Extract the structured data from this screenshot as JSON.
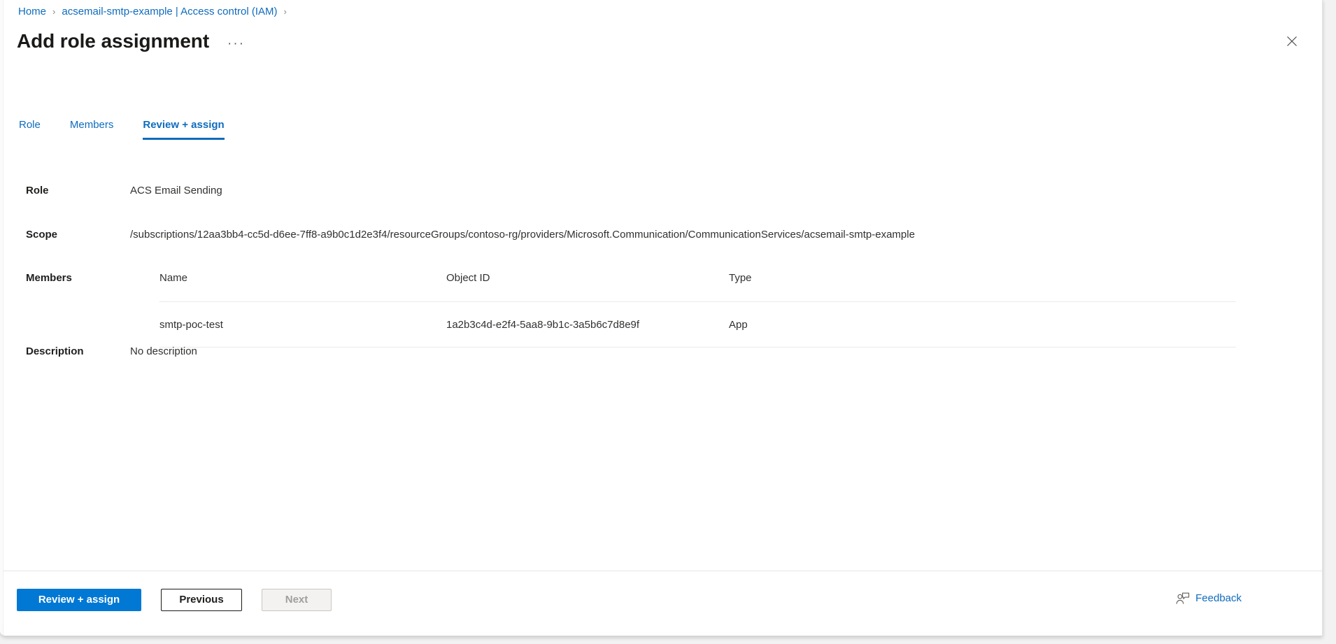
{
  "breadcrumb": {
    "items": [
      {
        "label": "Home"
      },
      {
        "label": "acsemail-smtp-example | Access control (IAM)"
      }
    ],
    "separator": "›"
  },
  "header": {
    "title": "Add role assignment",
    "more_menu": "···",
    "close_icon": "close-icon"
  },
  "tabs": [
    {
      "label": "Role",
      "active": false
    },
    {
      "label": "Members",
      "active": false
    },
    {
      "label": "Review + assign",
      "active": true
    }
  ],
  "details": {
    "role_label": "Role",
    "role_value": "ACS Email Sending",
    "scope_label": "Scope",
    "scope_value": "/subscriptions/12aa3bb4-cc5d-d6ee-7ff8-a9b0c1d2e3f4/resourceGroups/contoso-rg/providers/Microsoft.Communication/CommunicationServices/acsemail-smtp-example",
    "description_label": "Description",
    "description_value": "No description"
  },
  "members": {
    "label": "Members",
    "columns": [
      "Name",
      "Object ID",
      "Type"
    ],
    "rows": [
      {
        "name": "smtp-poc-test",
        "object_id": "1a2b3c4d-e2f4-5aa8-9b1c-3a5b6c7d8e9f",
        "type": "App"
      }
    ]
  },
  "footer": {
    "primary_label": "Review + assign",
    "previous_label": "Previous",
    "next_label": "Next",
    "feedback_label": "Feedback",
    "feedback_icon": "feedback-person-icon"
  },
  "colors": {
    "accent": "#0078d4",
    "link": "#0f6cbd",
    "text": "#323130",
    "disabled_text": "#a19f9d",
    "divider": "#edebe9"
  }
}
